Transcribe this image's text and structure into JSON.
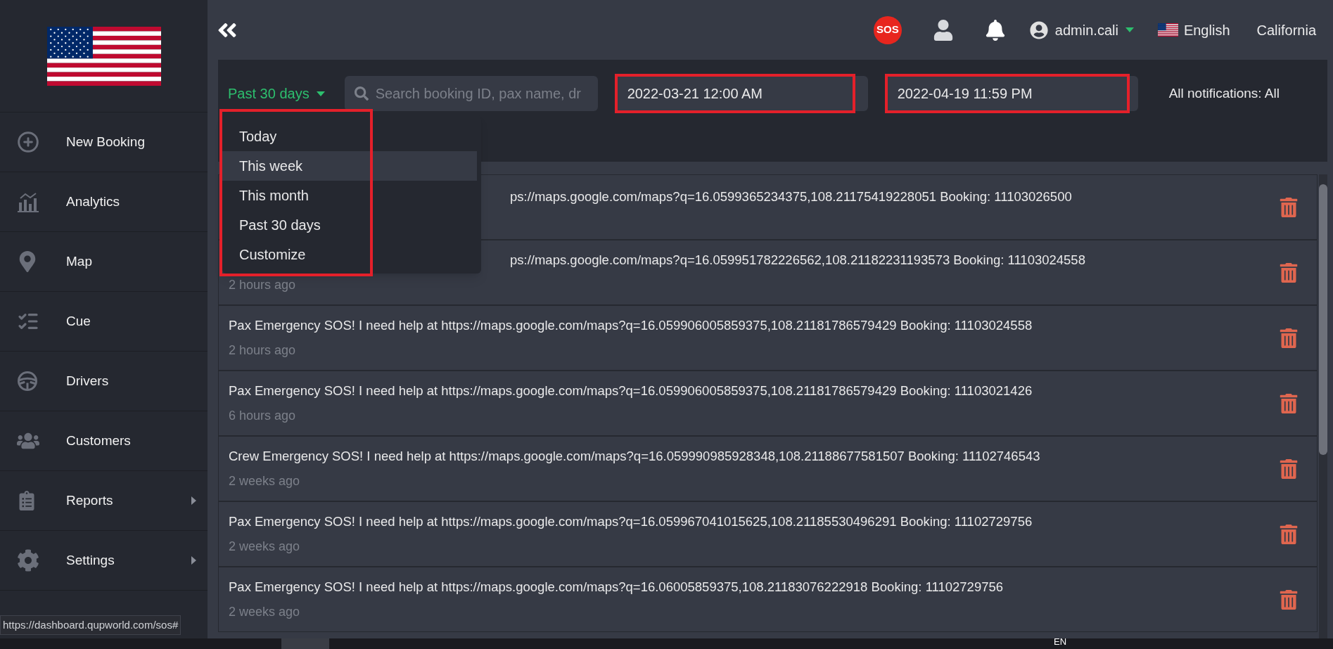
{
  "sidebar": {
    "items": [
      {
        "label": "New Booking",
        "selected": false,
        "expandable": false
      },
      {
        "label": "Analytics",
        "selected": false,
        "expandable": false
      },
      {
        "label": "Map",
        "selected": false,
        "expandable": false
      },
      {
        "label": "Cue",
        "selected": false,
        "expandable": false
      },
      {
        "label": "Drivers",
        "selected": false,
        "expandable": false
      },
      {
        "label": "Customers",
        "selected": false,
        "expandable": false
      },
      {
        "label": "Reports",
        "selected": false,
        "expandable": true
      },
      {
        "label": "Settings",
        "selected": false,
        "expandable": true
      }
    ]
  },
  "header": {
    "sos_label": "SOS",
    "user": "admin.cali",
    "language": "English",
    "region": "California"
  },
  "filters": {
    "range": "Past 30 days",
    "search": {
      "placeholder": "Search booking ID, pax name, dr"
    },
    "from": "2022-03-21 12:00 AM",
    "to": "2022-04-19 11:59 PM",
    "notifications": "All notifications: All"
  },
  "range_menu": {
    "options": [
      {
        "label": "Today",
        "selected": false
      },
      {
        "label": "This week",
        "selected": true
      },
      {
        "label": "This month",
        "selected": false
      },
      {
        "label": "Past 30 days",
        "selected": false
      },
      {
        "label": "Customize",
        "selected": false
      }
    ]
  },
  "notifications": [
    {
      "kind": "covered",
      "message": "ps://maps.google.com/maps?q=16.0599365234375,108.21175419228051 Booking: 11103026500"
    },
    {
      "kind": "covered",
      "message": "ps://maps.google.com/maps?q=16.059951782226562,108.21182231193573 Booking: 11103024558",
      "time": "2 hours ago"
    },
    {
      "kind": "full",
      "message": "Pax Emergency SOS! I need help at https://maps.google.com/maps?q=16.059906005859375,108.21181786579429 Booking: 11103024558",
      "time": "2 hours ago"
    },
    {
      "kind": "full",
      "message": "Pax Emergency SOS! I need help at https://maps.google.com/maps?q=16.059906005859375,108.21181786579429 Booking: 11103021426",
      "time": "6 hours ago"
    },
    {
      "kind": "full",
      "message": "Crew Emergency SOS! I need help at https://maps.google.com/maps?q=16.059990985928348,108.21188677581507 Booking: 11102746543",
      "time": "2 weeks ago"
    },
    {
      "kind": "full",
      "message": "Pax Emergency SOS! I need help at https://maps.google.com/maps?q=16.059967041015625,108.21185530496291 Booking: 11102729756",
      "time": "2 weeks ago"
    },
    {
      "kind": "full",
      "message": "Pax Emergency SOS! I need help at https://maps.google.com/maps?q=16.06005859375,108.21183076222918 Booking: 11102729756",
      "time": "2 weeks ago"
    }
  ],
  "status_url": "https://dashboard.qupworld.com/sos#",
  "taskbar": {
    "language": "EN"
  }
}
